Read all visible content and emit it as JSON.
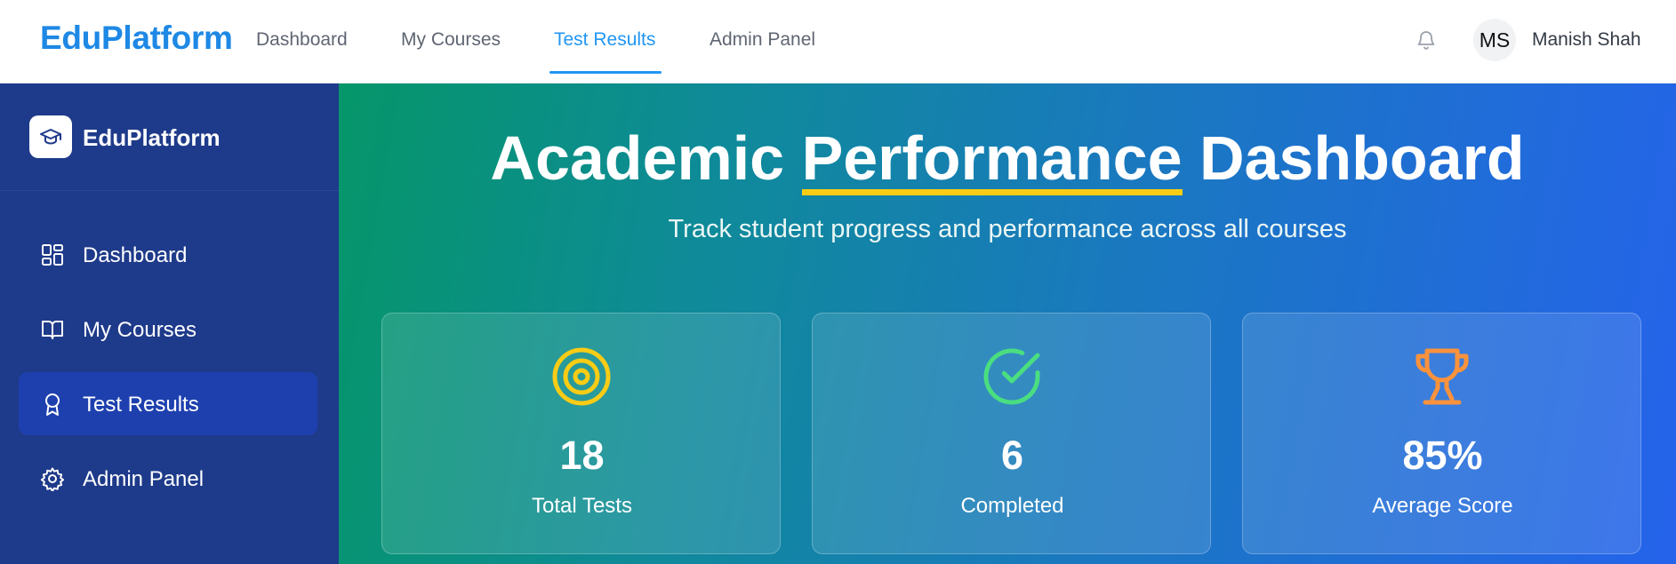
{
  "topbar": {
    "brand": "EduPlatform",
    "nav": [
      "Dashboard",
      "My Courses",
      "Test Results",
      "Admin Panel"
    ],
    "active_nav": "Test Results",
    "avatar_initials": "MS",
    "user_name": "Manish Shah",
    "bell_icon": "bell-icon"
  },
  "sidebar": {
    "brand": "EduPlatform",
    "logo_icon": "graduation-cap-icon",
    "items": [
      {
        "label": "Dashboard",
        "icon": "layout-grid-icon"
      },
      {
        "label": "My Courses",
        "icon": "book-open-icon"
      },
      {
        "label": "Test Results",
        "icon": "award-icon"
      },
      {
        "label": "Admin Panel",
        "icon": "gear-icon"
      }
    ],
    "active_item": "Test Results"
  },
  "hero": {
    "title_before": "Academic ",
    "title_highlight": "Performance",
    "title_after": " Dashboard",
    "subtitle": "Track student progress and performance across all courses"
  },
  "stats": [
    {
      "value": "18",
      "label": "Total Tests",
      "icon": "target-icon",
      "color": "#facc15"
    },
    {
      "value": "6",
      "label": "Completed",
      "icon": "check-circle-icon",
      "color": "#4ade80"
    },
    {
      "value": "85%",
      "label": "Average Score",
      "icon": "trophy-icon",
      "color": "#fb923c"
    }
  ],
  "colors": {
    "brand_blue": "#1e88e5",
    "sidebar_bg": "#1e3a8a",
    "sidebar_active": "#1e40af",
    "highlight_underline": "#facc15"
  }
}
